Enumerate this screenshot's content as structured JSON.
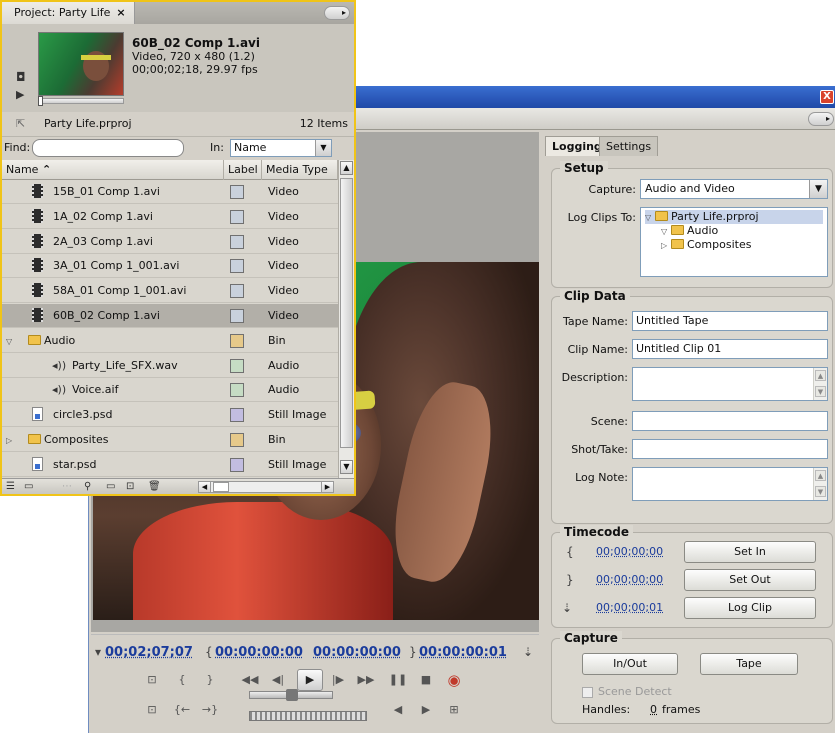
{
  "project": {
    "tab_label": "Project: Party Life",
    "close_glyph": "×",
    "clip_name": "60B_02 Comp 1.avi",
    "clip_info1": "Video, 720 x 480 (1.2)",
    "clip_info2": "00;00;02;18, 29.97 fps",
    "project_file": "Party Life.prproj",
    "item_count": "12 Items",
    "find_label": "Find:",
    "in_label": "In:",
    "in_value": "Name",
    "columns": {
      "name": "Name",
      "label": "Label",
      "media_type": "Media Type"
    },
    "items": [
      {
        "name": "15B_01 Comp 1.avi",
        "type": "Video",
        "icon": "film-icon",
        "label_color": "#c9d1dc"
      },
      {
        "name": "1A_02 Comp 1.avi",
        "type": "Video",
        "icon": "film-icon",
        "label_color": "#c9d1dc"
      },
      {
        "name": "2A_03 Comp 1.avi",
        "type": "Video",
        "icon": "film-icon",
        "label_color": "#c9d1dc"
      },
      {
        "name": "3A_01 Comp 1_001.avi",
        "type": "Video",
        "icon": "film-icon",
        "label_color": "#c9d1dc"
      },
      {
        "name": "58A_01 Comp 1_001.avi",
        "type": "Video",
        "icon": "film-icon",
        "label_color": "#c9d1dc"
      },
      {
        "name": "60B_02 Comp 1.avi",
        "type": "Video",
        "icon": "film-icon",
        "label_color": "#c9d1dc",
        "selected": true
      },
      {
        "name": "Audio",
        "type": "Bin",
        "icon": "folder-icon",
        "label_color": "#e6c98a",
        "expanded": true
      },
      {
        "name": "Party_Life_SFX.wav",
        "type": "Audio",
        "icon": "audio-icon",
        "label_color": "#c6dcc4",
        "indent": 1
      },
      {
        "name": "Voice.aif",
        "type": "Audio",
        "icon": "audio-icon",
        "label_color": "#c6dcc4",
        "indent": 1
      },
      {
        "name": "circle3.psd",
        "type": "Still Image",
        "icon": "psd-icon",
        "label_color": "#c2bde0"
      },
      {
        "name": "Composites",
        "type": "Bin",
        "icon": "folder-icon",
        "label_color": "#e6c98a",
        "expanded": false
      },
      {
        "name": "star.psd",
        "type": "Still Image",
        "icon": "psd-icon",
        "label_color": "#c2bde0"
      }
    ]
  },
  "capture": {
    "close_glyph": "X",
    "tabs": {
      "logging": "Logging",
      "settings": "Settings"
    },
    "setup": {
      "title": "Setup",
      "capture_label": "Capture:",
      "capture_value": "Audio and Video",
      "log_clips_label": "Log Clips To:",
      "tree": {
        "root": "Party Life.prproj",
        "child1": "Audio",
        "child2": "Composites"
      }
    },
    "clip_data": {
      "title": "Clip Data",
      "tape_name_label": "Tape Name:",
      "tape_name_value": "Untitled Tape",
      "clip_name_label": "Clip Name:",
      "clip_name_value": "Untitled Clip 01",
      "description_label": "Description:",
      "scene_label": "Scene:",
      "shot_take_label": "Shot/Take:",
      "log_note_label": "Log Note:"
    },
    "timecode": {
      "title": "Timecode",
      "in_value": "00;00;00;00",
      "out_value": "00;00;00;00",
      "dur_value": "00;00;00;01",
      "set_in": "Set In",
      "set_out": "Set Out",
      "log_clip": "Log Clip"
    },
    "capture_group": {
      "title": "Capture",
      "in_out": "In/Out",
      "tape": "Tape",
      "scene_detect": "Scene Detect",
      "handles_label": "Handles:",
      "handles_value": "0",
      "handles_unit": "frames"
    },
    "transport": {
      "current_tc": "00;02;07;07",
      "in_tc": "00:00:00:00",
      "out_tc": "00:00:00:00",
      "dur_tc": "00:00:00:01"
    }
  }
}
